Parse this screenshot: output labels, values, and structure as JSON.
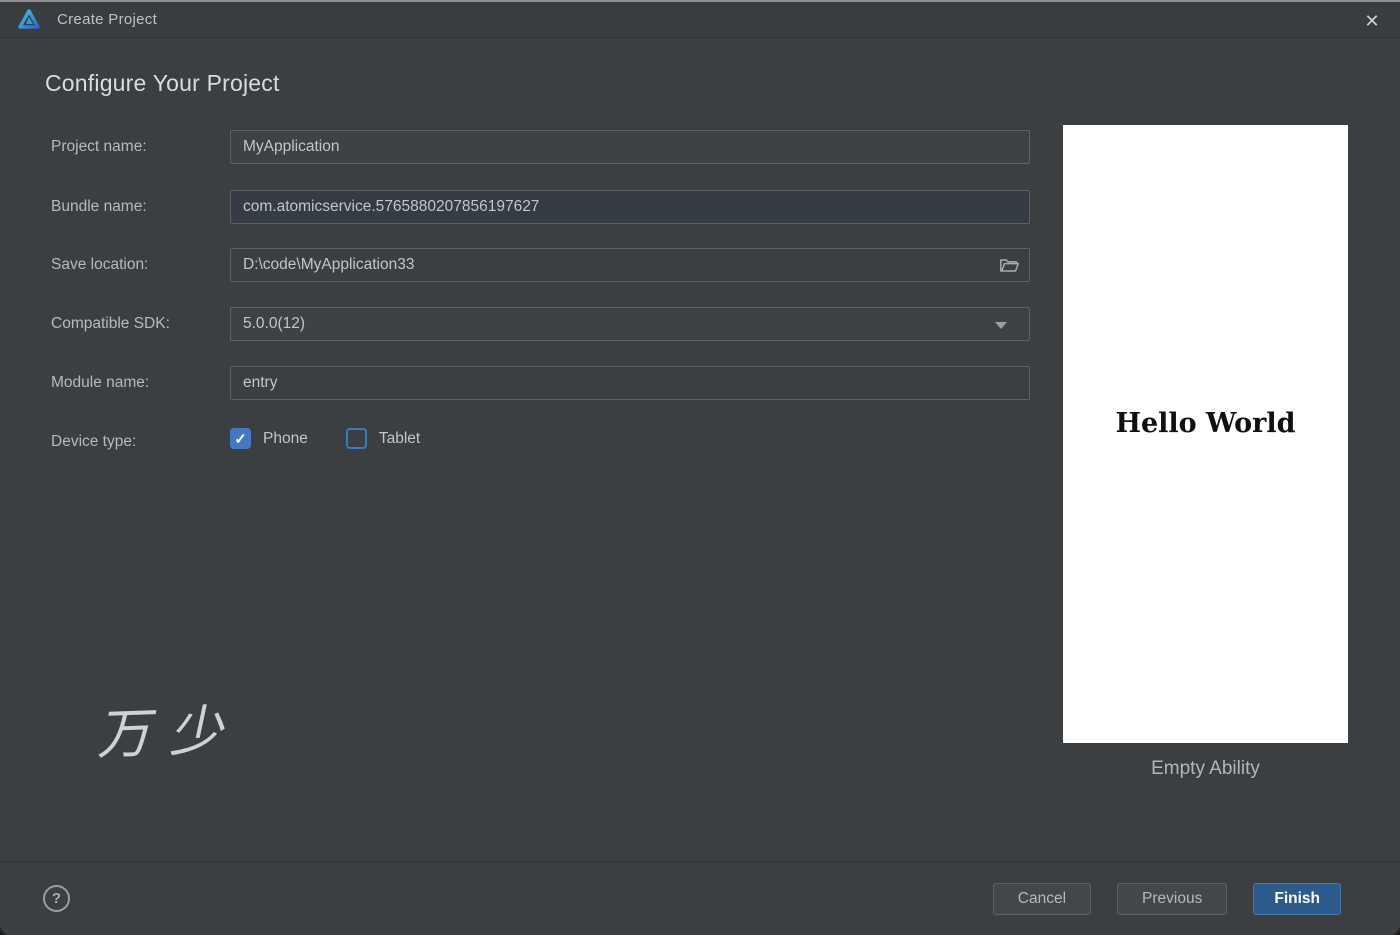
{
  "window": {
    "title": "Create Project",
    "close_glyph": "✕"
  },
  "header": {
    "heading": "Configure Your Project"
  },
  "form": {
    "fields": [
      {
        "label": "Project name:",
        "value": "MyApplication"
      },
      {
        "label": "Bundle name:",
        "value": "com.atomicservice.5765880207856197627"
      },
      {
        "label": "Save location:",
        "value": "D:\\code\\MyApplication33"
      },
      {
        "label": "Compatible SDK:",
        "value": "5.0.0(12)"
      },
      {
        "label": "Module name:",
        "value": "entry"
      }
    ],
    "device_type": {
      "label": "Device type:",
      "check_glyph": "✓",
      "options": [
        {
          "label": "Phone",
          "checked": true
        },
        {
          "label": "Tablet",
          "checked": false
        }
      ]
    }
  },
  "preview": {
    "hello_text": "Hello World",
    "caption": "Empty Ability"
  },
  "watermark": "万少",
  "footer": {
    "help_glyph": "?",
    "buttons": [
      {
        "label": "Cancel",
        "primary": false
      },
      {
        "label": "Previous",
        "primary": false
      },
      {
        "label": "Finish",
        "primary": true
      }
    ]
  },
  "colors": {
    "dialog_bg": "#3c3f41",
    "input_border": "#5d6163",
    "accent_blue": "#2d5b8c",
    "checkbox_blue": "#4678c2",
    "preview_bg": "#ffffff"
  }
}
